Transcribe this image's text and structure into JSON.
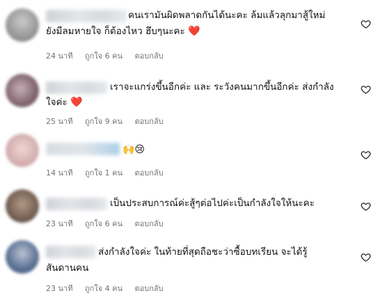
{
  "comments": [
    {
      "line1": "คนเรามันผิดพลาดกันได้นะคะ ล้มแล้วลุกมาสู้ใหม่",
      "line2": "ยังมีลมหายใจ ก็ต้องไหว ฮึบๆนะคะ",
      "emoji": "❤️",
      "time": "24 นาที",
      "likes": "ถูกใจ 6 คน",
      "reply": "ตอบกลับ"
    },
    {
      "line1": "เราจะแกร่งขึ้นอีกค่ะ และ ระวังคนมากขึ้นอีกค่ะ ส่งกำลัง",
      "line2": "ใจค่ะ",
      "emoji": "❤️",
      "time": "25 นาที",
      "likes": "ถูกใจ 9 คน",
      "reply": "ตอบกลับ"
    },
    {
      "line1": "",
      "emoji": "🙌😢",
      "time": "14 นาที",
      "likes": "ถูกใจ 1 คน",
      "reply": "ตอบกลับ"
    },
    {
      "line1": "เป็นประสบการณ์ค่ะสู้ๆต่อไปค่ะเป็นกำลังใจให้นะคะ",
      "time": "23 นาที",
      "likes": "ถูกใจ 6 คน",
      "reply": "ตอบกลับ"
    },
    {
      "line1": "ส่งกำลังใจค่ะ ในท้ายที่สุดถือชะว่าซื้อบทเรียน จะได้รู้",
      "line2": "สันดานคน",
      "time": "23 นาที",
      "likes": "ถูกใจ 4 คน",
      "reply": "ตอบกลับ"
    }
  ]
}
